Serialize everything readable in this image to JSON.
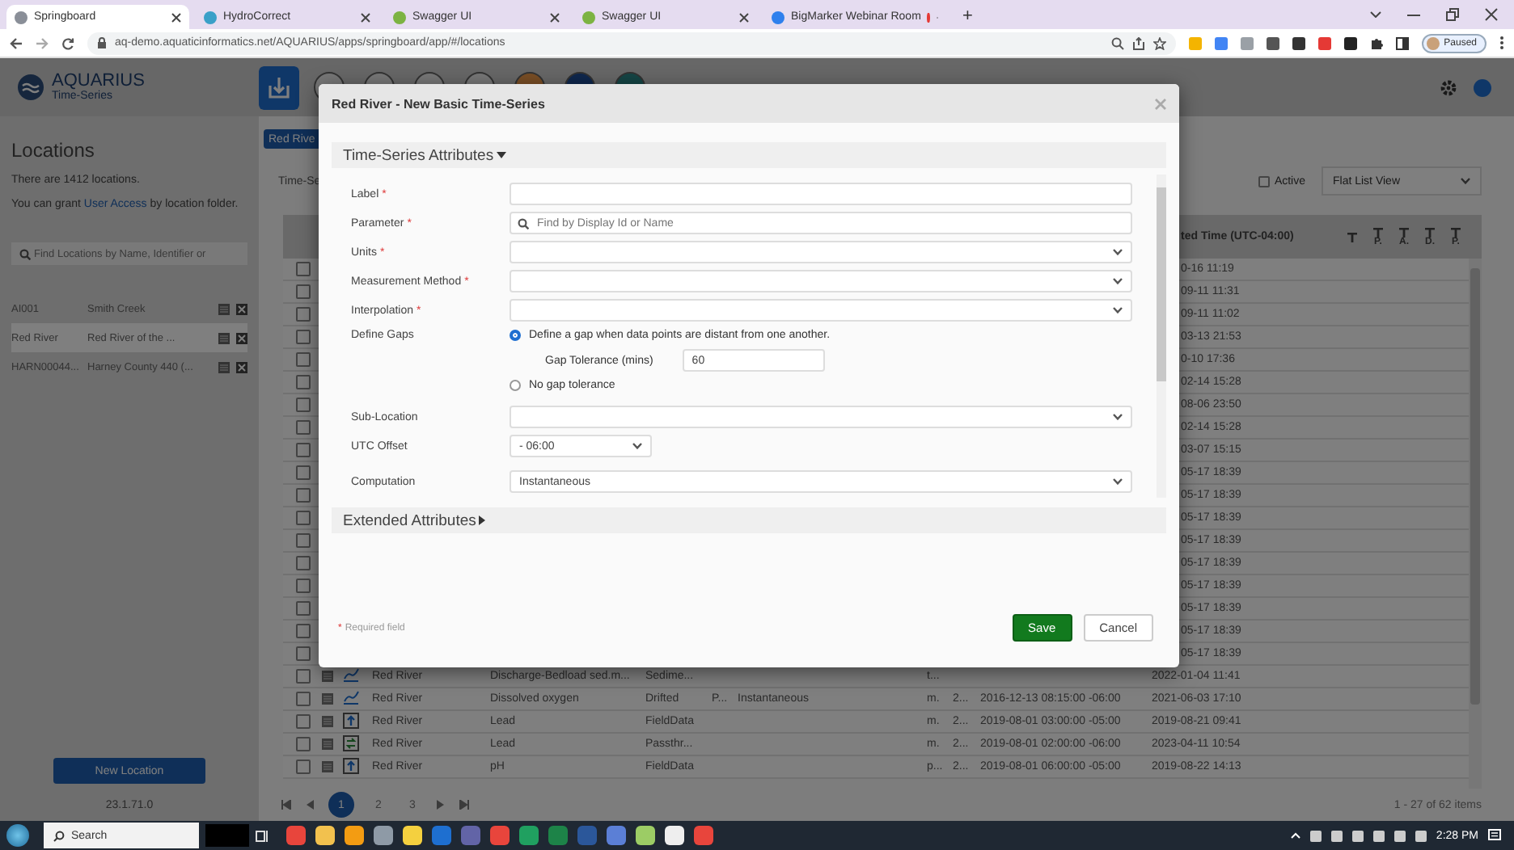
{
  "browser": {
    "tabs": [
      {
        "title": "Springboard",
        "selected": true,
        "recording": false
      },
      {
        "title": "HydroCorrect",
        "selected": false,
        "recording": false
      },
      {
        "title": "Swagger UI",
        "selected": false,
        "recording": false
      },
      {
        "title": "Swagger UI",
        "selected": false,
        "recording": false
      },
      {
        "title": "BigMarker Webinar Room",
        "selected": false,
        "recording": true
      }
    ],
    "new_tab": "+",
    "url": "aq-demo.aquaticinformatics.net/AQUARIUS/apps/springboard/app/#/locations",
    "profile": "Paused"
  },
  "app": {
    "logo_title": "AQUARIUS",
    "logo_subtitle": "Time-Series"
  },
  "locations_panel": {
    "title": "Locations",
    "count_text": "There are 1412 locations.",
    "access_before": "You can grant ",
    "access_link": "User Access",
    "access_after": " by location folder.",
    "search_placeholder": "Find Locations by Name, Identifier or",
    "items": [
      {
        "identifier": "AI001",
        "name": "Smith Creek",
        "selected": false
      },
      {
        "identifier": "Red River",
        "name": "Red River of the ...",
        "selected": true
      },
      {
        "identifier": "HARN00044...",
        "name": "Harney County 440 (...",
        "selected": false
      }
    ],
    "new_button": "New Location",
    "version": "23.1.71.0"
  },
  "main": {
    "location_button": "Red Rive",
    "tab": "Time-Se",
    "active_filter": {
      "label": "Active",
      "checked": false
    },
    "view_select": "Flat List View",
    "table": {
      "time_header": "ted Time (UTC-04:00)",
      "filter_columns": [
        {
          "label": "P."
        },
        {
          "label": "A."
        },
        {
          "label": "D."
        },
        {
          "label": "P."
        }
      ],
      "rows": [
        {
          "kind": "covered",
          "checked": false,
          "time": "0-16 11:19"
        },
        {
          "kind": "covered",
          "checked": false,
          "time": "09-11 11:31"
        },
        {
          "kind": "covered",
          "checked": false,
          "time": "09-11 11:02"
        },
        {
          "kind": "covered",
          "checked": false,
          "time": "03-13 21:53"
        },
        {
          "kind": "covered",
          "checked": false,
          "time": "0-10 17:36"
        },
        {
          "kind": "covered",
          "checked": false,
          "time": "02-14 15:28"
        },
        {
          "kind": "covered",
          "checked": false,
          "time": "08-06 23:50"
        },
        {
          "kind": "covered",
          "checked": false,
          "time": "02-14 15:28"
        },
        {
          "kind": "covered",
          "checked": false,
          "time": "03-07 15:15"
        },
        {
          "kind": "covered",
          "checked": false,
          "time": "05-17 18:39"
        },
        {
          "kind": "covered",
          "checked": false,
          "time": "05-17 18:39"
        },
        {
          "kind": "covered",
          "checked": false,
          "time": "05-17 18:39"
        },
        {
          "kind": "covered",
          "checked": false,
          "time": "05-17 18:39"
        },
        {
          "kind": "covered",
          "checked": false,
          "time": "05-17 18:39"
        },
        {
          "kind": "covered",
          "checked": false,
          "time": "05-17 18:39"
        },
        {
          "kind": "covered",
          "checked": false,
          "time": "05-17 18:39"
        },
        {
          "kind": "covered",
          "checked": false,
          "time": "05-17 18:39"
        },
        {
          "kind": "covered",
          "checked": false,
          "time": "05-17 18:39"
        },
        {
          "kind": "full",
          "checked": false,
          "series_icon": {
            "kind": "line"
          },
          "location": "Red River",
          "parameter": "Discharge-Bedload sed.m...",
          "label": "Sedime...",
          "column_6": "t...",
          "time": "2022-01-04 11:41"
        },
        {
          "kind": "full",
          "checked": false,
          "series_icon": {
            "kind": "line"
          },
          "location": "Red River",
          "parameter": "Dissolved oxygen",
          "label": "Drifted",
          "column_4": "P...",
          "column_5": "Instantaneous",
          "column_6": "m.",
          "column_7": "2...",
          "column_8": "2016-12-13 08:15:00 -06:00",
          "time": "2021-06-03 17:10"
        },
        {
          "kind": "full",
          "checked": false,
          "series_icon": {
            "kind": "upload"
          },
          "location": "Red River",
          "parameter": "Lead",
          "label": "FieldData",
          "column_6": "m.",
          "column_7": "2...",
          "column_8": "2019-08-01 03:00:00 -05:00",
          "time": "2019-08-21 09:41"
        },
        {
          "kind": "full",
          "checked": false,
          "series_icon": {
            "kind": "swap"
          },
          "location": "Red River",
          "parameter": "Lead",
          "label": "Passthr...",
          "column_6": "m.",
          "column_7": "2...",
          "column_8": "2019-08-01 02:00:00 -06:00",
          "time": "2023-04-11 10:54"
        },
        {
          "kind": "full",
          "checked": false,
          "series_icon": {
            "kind": "upload"
          },
          "location": "Red River",
          "parameter": "pH",
          "label": "FieldData",
          "column_6": "p...",
          "column_7": "2...",
          "column_8": "2019-08-01 06:00:00 -05:00",
          "time": "2019-08-22 14:13"
        }
      ]
    },
    "pages": [
      {
        "label": "1",
        "selected": true
      },
      {
        "label": "2",
        "selected": false
      },
      {
        "label": "3",
        "selected": false
      }
    ],
    "summary": "1 - 27 of 62 items"
  },
  "dialog": {
    "title": "Red River - New Basic Time-Series",
    "required_mark": "*",
    "attributes_section": {
      "title": "Time-Series Attributes",
      "expanded": true,
      "fields": [
        {
          "kind": "text",
          "label": "Label",
          "required": true
        },
        {
          "kind": "search",
          "label": "Parameter",
          "required": true,
          "placeholder": "Find by Display Id or Name"
        },
        {
          "kind": "select",
          "label": "Units",
          "required": true
        },
        {
          "kind": "select",
          "label": "Measurement Method",
          "required": true
        },
        {
          "kind": "select",
          "label": "Interpolation",
          "required": true
        },
        {
          "kind": "radio",
          "label": "Define Gaps",
          "required": false,
          "options": [
            {
              "label": "Define a gap when data points are distant from one another.",
              "selected": true,
              "tolerance": {
                "label": "Gap Tolerance (mins)",
                "value": "60"
              }
            },
            {
              "label": "No gap tolerance",
              "selected": false
            }
          ]
        },
        {
          "kind": "select",
          "label": "Sub-Location",
          "required": false
        },
        {
          "kind": "short-select",
          "label": "UTC Offset",
          "required": false,
          "value": "- 06:00"
        },
        {
          "kind": "select",
          "label": "Computation",
          "required": false,
          "value": "Instantaneous"
        }
      ]
    },
    "extended_section": {
      "title": "Extended Attributes",
      "expanded": false
    },
    "required_note": "Required field",
    "buttons": [
      {
        "label": "Save",
        "kind": "primary"
      },
      {
        "label": "Cancel",
        "kind": "secondary"
      }
    ]
  },
  "taskbar": {
    "search": "Search",
    "time": "2:28 PM"
  }
}
